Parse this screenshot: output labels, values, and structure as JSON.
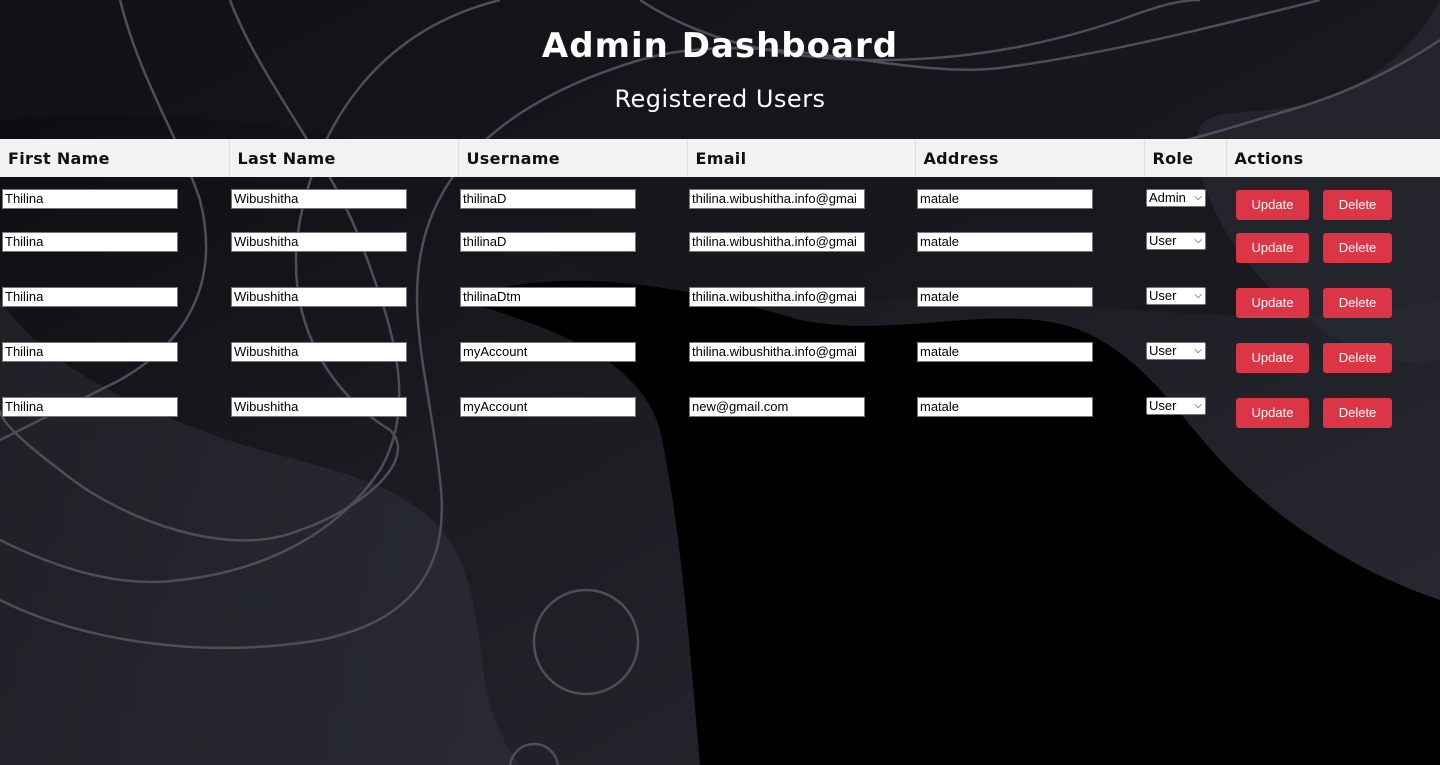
{
  "header": {
    "title": "Admin Dashboard",
    "subtitle": "Registered Users"
  },
  "table": {
    "columns": [
      "First Name",
      "Last Name",
      "Username",
      "Email",
      "Address",
      "Role",
      "Actions"
    ],
    "update_label": "Update",
    "delete_label": "Delete",
    "rows": [
      {
        "first_name": "Thilina",
        "last_name": "Wibushitha",
        "username": "thilinaD",
        "email": "thilina.wibushitha.info@gmai",
        "address": "matale",
        "role": "Admin"
      },
      {
        "first_name": "Thilina",
        "last_name": "Wibushitha",
        "username": "thilinaD",
        "email": "thilina.wibushitha.info@gmai",
        "address": "matale",
        "role": "User"
      },
      {
        "first_name": "Thilina",
        "last_name": "Wibushitha",
        "username": "thilinaDtm",
        "email": "thilina.wibushitha.info@gmai",
        "address": "matale",
        "role": "User"
      },
      {
        "first_name": "Thilina",
        "last_name": "Wibushitha",
        "username": "myAccount",
        "email": "thilina.wibushitha.info@gmai",
        "address": "matale",
        "role": "User"
      },
      {
        "first_name": "Thilina",
        "last_name": "Wibushitha",
        "username": "myAccount",
        "email": "new@gmail.com",
        "address": "matale",
        "role": "User"
      }
    ]
  },
  "colors": {
    "button": "#dc3545",
    "header_bg": "#f2f2f2",
    "page_bg": "#000000"
  }
}
